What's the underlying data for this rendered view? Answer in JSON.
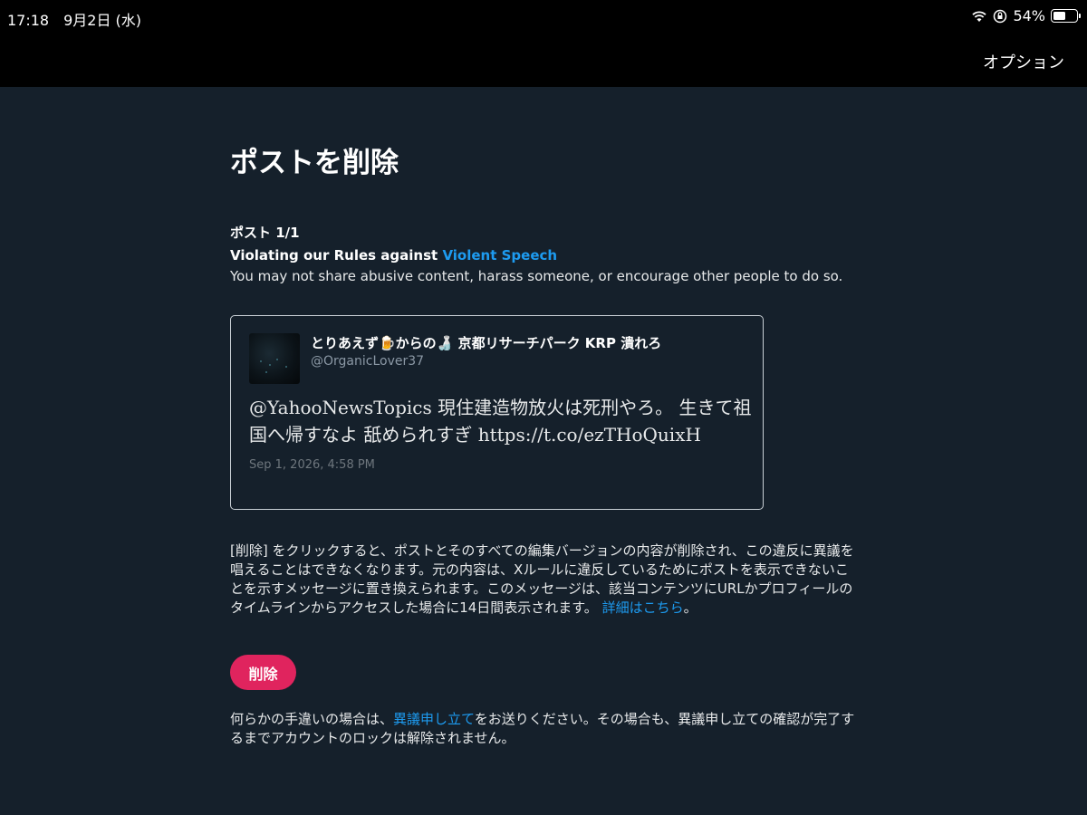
{
  "status_bar": {
    "time_date": "17:18　9月2日 (水)",
    "battery_percent": "54%",
    "battery_level": 0.54
  },
  "nav": {
    "options_label": "オプション"
  },
  "page": {
    "title": "ポストを削除",
    "post_count": "ポスト 1/1",
    "violation_prefix": "Violating our Rules against ",
    "violation_link": "Violent Speech",
    "violation_description": "You may not share abusive content, harass someone, or encourage other people to do so."
  },
  "tweet": {
    "display_name": "とりあえず🍺からの🍶 京都リサーチパーク KRP 潰れろ",
    "handle": "@OrganicLover37",
    "text": "@YahooNewsTopics 現住建造物放火は死刑やろ。 生きて祖国へ帰すなよ 舐められすぎ https://t.co/ezTHoQuixH",
    "date": "Sep 1, 2026, 4:58 PM"
  },
  "info": {
    "text": "[削除] をクリックすると、ポストとそのすべての編集バージョンの内容が削除され、この違反に異議を唱えることはできなくなります。元の内容は、Xルールに違反しているためにポストを表示できないことを示すメッセージに置き換えられます。このメッセージは、該当コンテンツにURLかプロフィールのタイムラインからアクセスした場合に14日間表示されます。",
    "link": "詳細はこちら",
    "suffix": "。"
  },
  "delete_button_label": "削除",
  "appeal": {
    "prefix": "何らかの手違いの場合は、",
    "link": "異議申し立て",
    "suffix": "をお送りください。その場合も、異議申し立ての確認が完了するまでアカウントのロックは解除されません。"
  },
  "colors": {
    "background": "#15202b",
    "accent_link": "#1d9bf0",
    "delete_button": "#e0245e"
  }
}
